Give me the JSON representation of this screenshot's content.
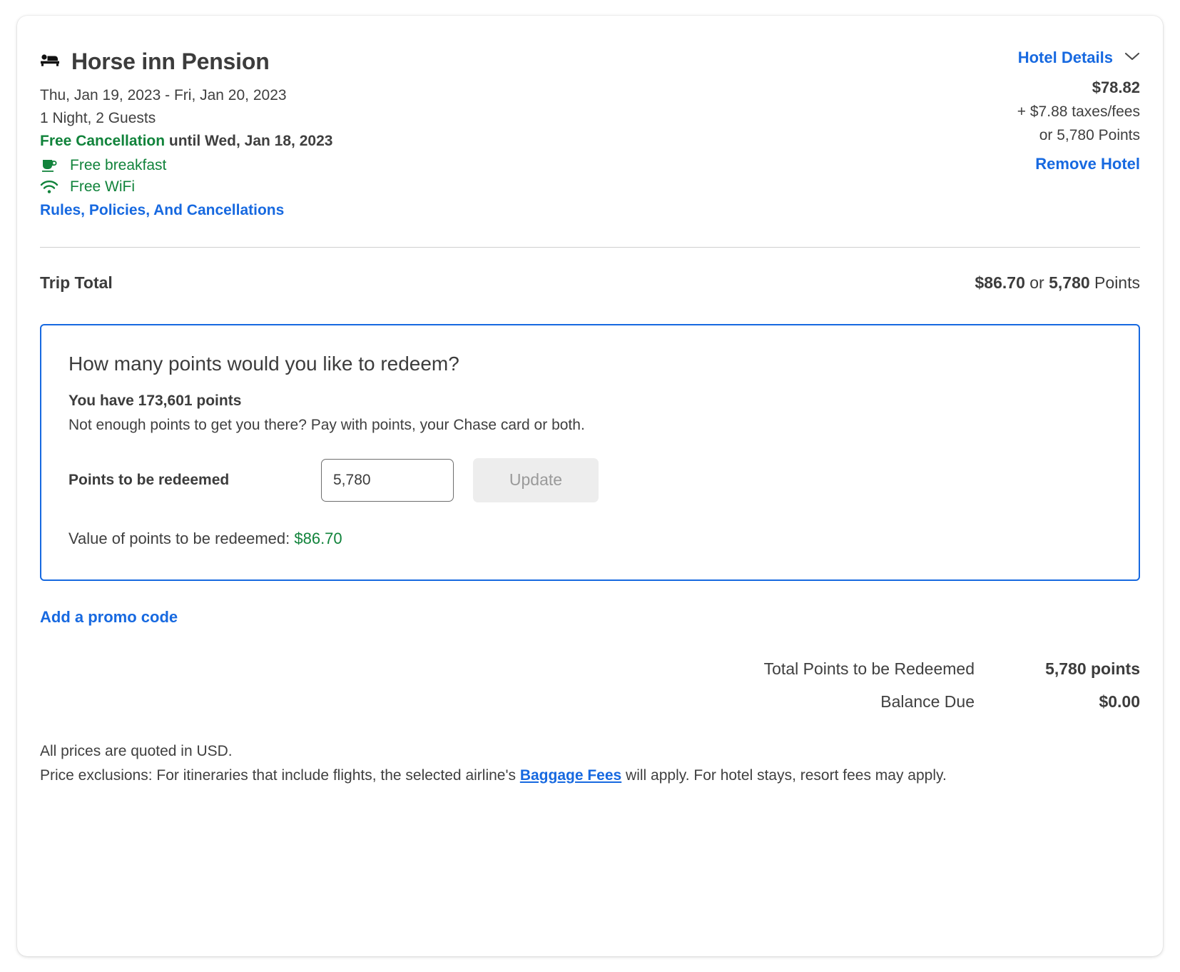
{
  "hotel": {
    "icon": "bed-icon",
    "name": "Horse inn Pension",
    "dates": "Thu, Jan 19, 2023 - Fri, Jan 20, 2023",
    "occupancy": "1 Night, 2 Guests",
    "cancellation_prefix": "Free Cancellation",
    "cancellation_rest": " until Wed, Jan 18, 2023",
    "amenities": [
      {
        "icon": "coffee-cup-icon",
        "label": "Free breakfast"
      },
      {
        "icon": "wifi-icon",
        "label": "Free WiFi"
      }
    ],
    "rules_link": "Rules, Policies, And Cancellations",
    "details_link": "Hotel Details",
    "details_chevron": "chevron-down-icon",
    "price": "$78.82",
    "taxes": "+ $7.88 taxes/fees",
    "points": "or 5,780 Points",
    "remove_link": "Remove Hotel"
  },
  "trip_total": {
    "label": "Trip Total",
    "amount": "$86.70",
    "conjunction": " or ",
    "points": "5,780",
    "points_suffix": " Points"
  },
  "points_box": {
    "question": "How many points would you like to redeem?",
    "balance": "You have 173,601 points",
    "subtext": "Not enough points to get you there? Pay with points, your Chase card or both.",
    "input_label": "Points to be redeemed",
    "input_value": "5,780",
    "input_placeholder": "Points",
    "update_button": "Update",
    "value_label": "Value of points to be redeemed: ",
    "value_amount": "$86.70"
  },
  "promo": {
    "link": "Add a promo code"
  },
  "summary": {
    "rows": [
      {
        "label": "Total Points to be Redeemed",
        "value": "5,780 points"
      },
      {
        "label": "Balance Due",
        "value": "$0.00"
      }
    ]
  },
  "fineprint": {
    "line1": "All prices are quoted in USD.",
    "line2_part1": "Price exclusions: For itineraries that include flights, the selected airline's ",
    "baggage_link": "Baggage Fees",
    "line2_part2": " will apply. For hotel stays, resort fees may apply."
  },
  "colors": {
    "link_blue": "#1769e0",
    "green": "#11833b",
    "text": "#3c3c3c",
    "border_gray": "#cfcfcf",
    "button_gray": "#ededed"
  }
}
